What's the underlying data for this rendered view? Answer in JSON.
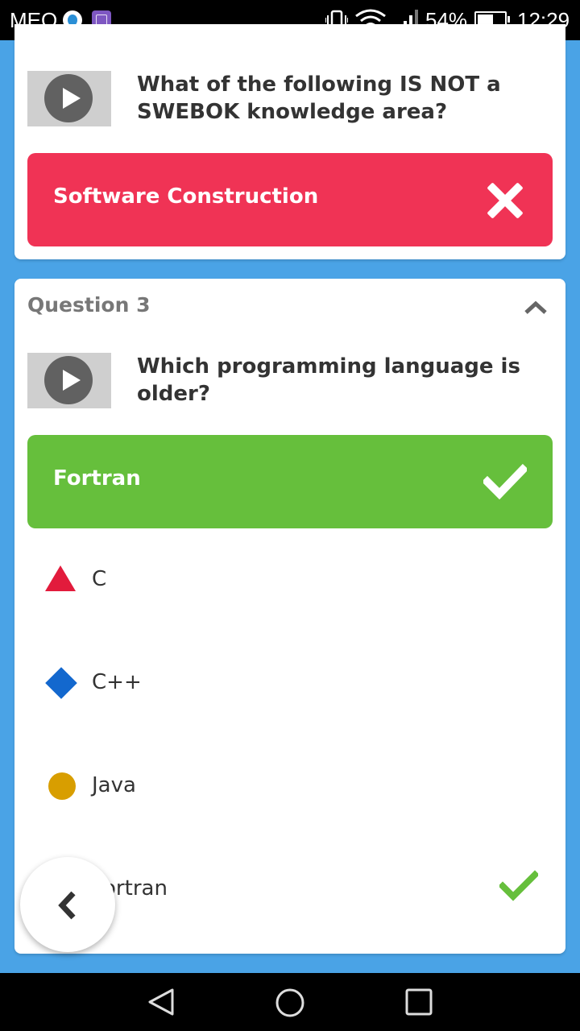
{
  "status_bar": {
    "carrier": "MEO",
    "battery": "54%",
    "time": "12:29",
    "icons": [
      "meo-app-icon",
      "gallery-app-icon",
      "vibrate-icon",
      "wifi-icon",
      "signal-icon",
      "battery-icon"
    ]
  },
  "previous_question": {
    "text": "What of the following IS NOT a SWEBOK knowledge area?",
    "answer": {
      "label": "Software Construction",
      "result": "wrong",
      "color": "#f03355"
    }
  },
  "question3": {
    "header": "Question 3",
    "text": "Which programming language is older?",
    "answer": {
      "label": "Fortran",
      "result": "correct",
      "color": "#66bf3c"
    },
    "options": [
      {
        "label": "C",
        "shape": "triangle",
        "color": "#e21b3c",
        "correct": false
      },
      {
        "label": "C++",
        "shape": "diamond",
        "color": "#1368ce",
        "correct": false
      },
      {
        "label": "Java",
        "shape": "circle",
        "color": "#d89e00",
        "correct": false
      },
      {
        "label": "Fortran",
        "shape": "square",
        "color": "#26890c",
        "correct": true
      }
    ]
  },
  "back_button": {
    "icon": "chevron-left-icon"
  },
  "nav_bar": {
    "icons": [
      "back-triangle-icon",
      "home-circle-icon",
      "recents-square-icon"
    ]
  }
}
